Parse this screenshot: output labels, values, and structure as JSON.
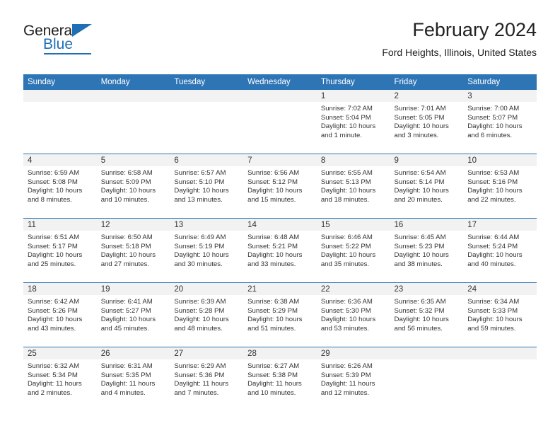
{
  "brand": {
    "name_part1": "General",
    "name_part2": "Blue",
    "accent_color": "#1f6fb5"
  },
  "header": {
    "title": "February 2024",
    "subtitle": "Ford Heights, Illinois, United States"
  },
  "theme": {
    "header_blue": "#2e75b6",
    "band_gray": "#f2f2f2",
    "text": "#333333"
  },
  "weekdays": [
    "Sunday",
    "Monday",
    "Tuesday",
    "Wednesday",
    "Thursday",
    "Friday",
    "Saturday"
  ],
  "weeks": [
    [
      {
        "day": "",
        "sunrise": "",
        "sunset": "",
        "daylight1": "",
        "daylight2": ""
      },
      {
        "day": "",
        "sunrise": "",
        "sunset": "",
        "daylight1": "",
        "daylight2": ""
      },
      {
        "day": "",
        "sunrise": "",
        "sunset": "",
        "daylight1": "",
        "daylight2": ""
      },
      {
        "day": "",
        "sunrise": "",
        "sunset": "",
        "daylight1": "",
        "daylight2": ""
      },
      {
        "day": "1",
        "sunrise": "Sunrise: 7:02 AM",
        "sunset": "Sunset: 5:04 PM",
        "daylight1": "Daylight: 10 hours",
        "daylight2": "and 1 minute."
      },
      {
        "day": "2",
        "sunrise": "Sunrise: 7:01 AM",
        "sunset": "Sunset: 5:05 PM",
        "daylight1": "Daylight: 10 hours",
        "daylight2": "and 3 minutes."
      },
      {
        "day": "3",
        "sunrise": "Sunrise: 7:00 AM",
        "sunset": "Sunset: 5:07 PM",
        "daylight1": "Daylight: 10 hours",
        "daylight2": "and 6 minutes."
      }
    ],
    [
      {
        "day": "4",
        "sunrise": "Sunrise: 6:59 AM",
        "sunset": "Sunset: 5:08 PM",
        "daylight1": "Daylight: 10 hours",
        "daylight2": "and 8 minutes."
      },
      {
        "day": "5",
        "sunrise": "Sunrise: 6:58 AM",
        "sunset": "Sunset: 5:09 PM",
        "daylight1": "Daylight: 10 hours",
        "daylight2": "and 10 minutes."
      },
      {
        "day": "6",
        "sunrise": "Sunrise: 6:57 AM",
        "sunset": "Sunset: 5:10 PM",
        "daylight1": "Daylight: 10 hours",
        "daylight2": "and 13 minutes."
      },
      {
        "day": "7",
        "sunrise": "Sunrise: 6:56 AM",
        "sunset": "Sunset: 5:12 PM",
        "daylight1": "Daylight: 10 hours",
        "daylight2": "and 15 minutes."
      },
      {
        "day": "8",
        "sunrise": "Sunrise: 6:55 AM",
        "sunset": "Sunset: 5:13 PM",
        "daylight1": "Daylight: 10 hours",
        "daylight2": "and 18 minutes."
      },
      {
        "day": "9",
        "sunrise": "Sunrise: 6:54 AM",
        "sunset": "Sunset: 5:14 PM",
        "daylight1": "Daylight: 10 hours",
        "daylight2": "and 20 minutes."
      },
      {
        "day": "10",
        "sunrise": "Sunrise: 6:53 AM",
        "sunset": "Sunset: 5:16 PM",
        "daylight1": "Daylight: 10 hours",
        "daylight2": "and 22 minutes."
      }
    ],
    [
      {
        "day": "11",
        "sunrise": "Sunrise: 6:51 AM",
        "sunset": "Sunset: 5:17 PM",
        "daylight1": "Daylight: 10 hours",
        "daylight2": "and 25 minutes."
      },
      {
        "day": "12",
        "sunrise": "Sunrise: 6:50 AM",
        "sunset": "Sunset: 5:18 PM",
        "daylight1": "Daylight: 10 hours",
        "daylight2": "and 27 minutes."
      },
      {
        "day": "13",
        "sunrise": "Sunrise: 6:49 AM",
        "sunset": "Sunset: 5:19 PM",
        "daylight1": "Daylight: 10 hours",
        "daylight2": "and 30 minutes."
      },
      {
        "day": "14",
        "sunrise": "Sunrise: 6:48 AM",
        "sunset": "Sunset: 5:21 PM",
        "daylight1": "Daylight: 10 hours",
        "daylight2": "and 33 minutes."
      },
      {
        "day": "15",
        "sunrise": "Sunrise: 6:46 AM",
        "sunset": "Sunset: 5:22 PM",
        "daylight1": "Daylight: 10 hours",
        "daylight2": "and 35 minutes."
      },
      {
        "day": "16",
        "sunrise": "Sunrise: 6:45 AM",
        "sunset": "Sunset: 5:23 PM",
        "daylight1": "Daylight: 10 hours",
        "daylight2": "and 38 minutes."
      },
      {
        "day": "17",
        "sunrise": "Sunrise: 6:44 AM",
        "sunset": "Sunset: 5:24 PM",
        "daylight1": "Daylight: 10 hours",
        "daylight2": "and 40 minutes."
      }
    ],
    [
      {
        "day": "18",
        "sunrise": "Sunrise: 6:42 AM",
        "sunset": "Sunset: 5:26 PM",
        "daylight1": "Daylight: 10 hours",
        "daylight2": "and 43 minutes."
      },
      {
        "day": "19",
        "sunrise": "Sunrise: 6:41 AM",
        "sunset": "Sunset: 5:27 PM",
        "daylight1": "Daylight: 10 hours",
        "daylight2": "and 45 minutes."
      },
      {
        "day": "20",
        "sunrise": "Sunrise: 6:39 AM",
        "sunset": "Sunset: 5:28 PM",
        "daylight1": "Daylight: 10 hours",
        "daylight2": "and 48 minutes."
      },
      {
        "day": "21",
        "sunrise": "Sunrise: 6:38 AM",
        "sunset": "Sunset: 5:29 PM",
        "daylight1": "Daylight: 10 hours",
        "daylight2": "and 51 minutes."
      },
      {
        "day": "22",
        "sunrise": "Sunrise: 6:36 AM",
        "sunset": "Sunset: 5:30 PM",
        "daylight1": "Daylight: 10 hours",
        "daylight2": "and 53 minutes."
      },
      {
        "day": "23",
        "sunrise": "Sunrise: 6:35 AM",
        "sunset": "Sunset: 5:32 PM",
        "daylight1": "Daylight: 10 hours",
        "daylight2": "and 56 minutes."
      },
      {
        "day": "24",
        "sunrise": "Sunrise: 6:34 AM",
        "sunset": "Sunset: 5:33 PM",
        "daylight1": "Daylight: 10 hours",
        "daylight2": "and 59 minutes."
      }
    ],
    [
      {
        "day": "25",
        "sunrise": "Sunrise: 6:32 AM",
        "sunset": "Sunset: 5:34 PM",
        "daylight1": "Daylight: 11 hours",
        "daylight2": "and 2 minutes."
      },
      {
        "day": "26",
        "sunrise": "Sunrise: 6:31 AM",
        "sunset": "Sunset: 5:35 PM",
        "daylight1": "Daylight: 11 hours",
        "daylight2": "and 4 minutes."
      },
      {
        "day": "27",
        "sunrise": "Sunrise: 6:29 AM",
        "sunset": "Sunset: 5:36 PM",
        "daylight1": "Daylight: 11 hours",
        "daylight2": "and 7 minutes."
      },
      {
        "day": "28",
        "sunrise": "Sunrise: 6:27 AM",
        "sunset": "Sunset: 5:38 PM",
        "daylight1": "Daylight: 11 hours",
        "daylight2": "and 10 minutes."
      },
      {
        "day": "29",
        "sunrise": "Sunrise: 6:26 AM",
        "sunset": "Sunset: 5:39 PM",
        "daylight1": "Daylight: 11 hours",
        "daylight2": "and 12 minutes."
      },
      {
        "day": "",
        "sunrise": "",
        "sunset": "",
        "daylight1": "",
        "daylight2": ""
      },
      {
        "day": "",
        "sunrise": "",
        "sunset": "",
        "daylight1": "",
        "daylight2": ""
      }
    ]
  ]
}
